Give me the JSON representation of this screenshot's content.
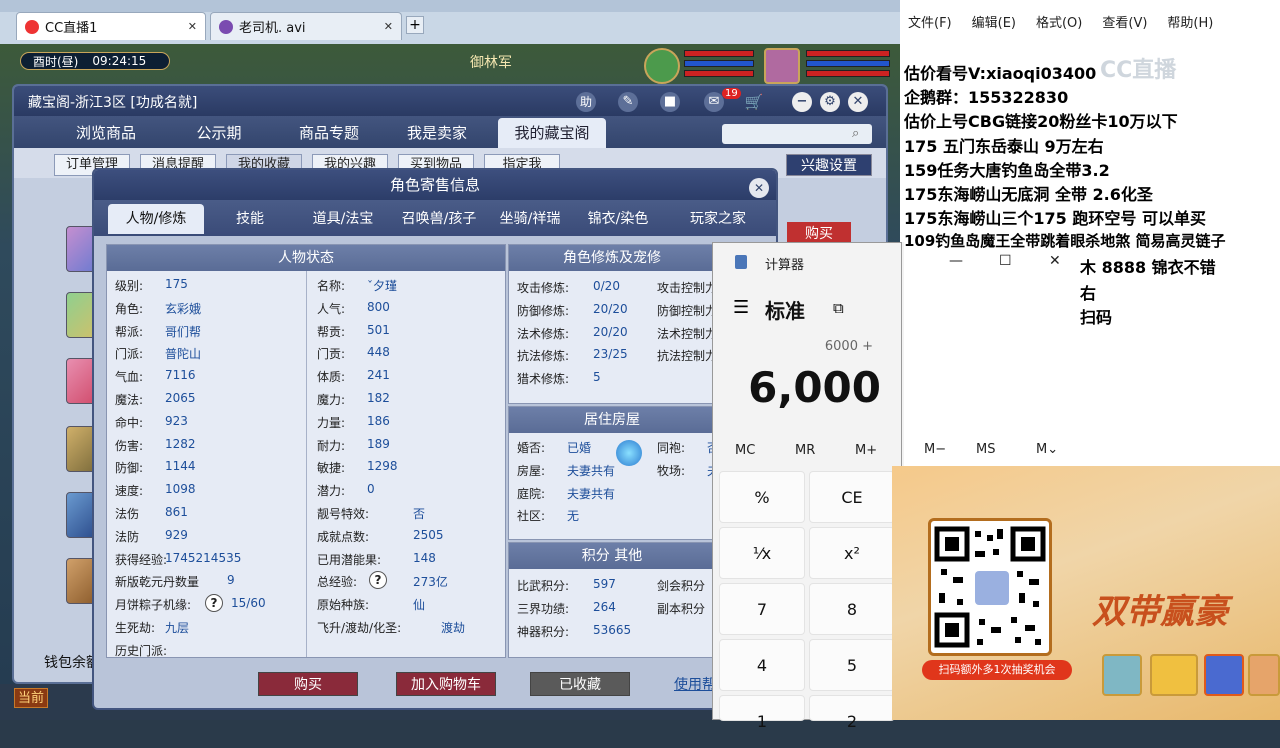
{
  "browser": {
    "tabs": [
      {
        "label": "CC直播1",
        "icon": "cc-logo-icon"
      },
      {
        "label": "老司机. avi",
        "icon": "avatar-icon"
      }
    ]
  },
  "game_hud": {
    "time_label": "酉时(昼)",
    "clock": "09:24:15",
    "banner": "御林军",
    "bottom_button": "当前"
  },
  "store": {
    "title": "藏宝阁-浙江3区 [功成名就]",
    "help_label": "助",
    "cart_badge": "19",
    "nav": [
      "浏览商品",
      "公示期",
      "商品专题",
      "我是卖家",
      "我的藏宝阁"
    ],
    "nav_active": 4,
    "subnav": [
      "订单管理",
      "消息提醒",
      "我的收藏",
      "我的兴趣",
      "买到物品",
      "指定我"
    ],
    "interest_button": "兴趣设置",
    "side_buy": "购买",
    "wallet_label": "钱包余额"
  },
  "dialog": {
    "title": "角色寄售信息",
    "close": "✕",
    "tabs": [
      "人物/修炼",
      "技能",
      "道具/法宝",
      "召唤兽/孩子",
      "坐骑/祥瑞",
      "锦衣/染色",
      "玩家之家"
    ],
    "status_title": "人物状态",
    "left_col": [
      {
        "k": "级别:",
        "v": "175"
      },
      {
        "k": "角色:",
        "v": "玄彩娥"
      },
      {
        "k": "帮派:",
        "v": "哥们帮"
      },
      {
        "k": "门派:",
        "v": "普陀山"
      },
      {
        "k": "气血:",
        "v": "7116"
      },
      {
        "k": "魔法:",
        "v": "2065"
      },
      {
        "k": "命中:",
        "v": "923"
      },
      {
        "k": "伤害:",
        "v": "1282"
      },
      {
        "k": "防御:",
        "v": "1144"
      },
      {
        "k": "速度:",
        "v": "1098"
      },
      {
        "k": "法伤",
        "v": "861"
      },
      {
        "k": "法防",
        "v": "929"
      },
      {
        "k": "获得经验:",
        "v": "1745214535"
      },
      {
        "k": "新版乾元丹数量",
        "v": "9"
      },
      {
        "k": "月饼粽子机缘:",
        "v": "15/60"
      },
      {
        "k": "生死劫:",
        "v": "九层"
      },
      {
        "k": "历史门派:",
        "v": ""
      }
    ],
    "mid_col": [
      {
        "k": "名称:",
        "v": "ˇ夕瑾"
      },
      {
        "k": "人气:",
        "v": "800"
      },
      {
        "k": "帮贡:",
        "v": "501"
      },
      {
        "k": "门贡:",
        "v": "448"
      },
      {
        "k": "体质:",
        "v": "241"
      },
      {
        "k": "魔力:",
        "v": "182"
      },
      {
        "k": "力量:",
        "v": "186"
      },
      {
        "k": "耐力:",
        "v": "189"
      },
      {
        "k": "敏捷:",
        "v": "1298"
      },
      {
        "k": "潜力:",
        "v": "0"
      },
      {
        "k": "靓号特效:",
        "v": "否"
      },
      {
        "k": "成就点数:",
        "v": "2505"
      },
      {
        "k": "已用潜能果:",
        "v": "148"
      },
      {
        "k": "总经验:",
        "v": "273亿"
      },
      {
        "k": "原始种族:",
        "v": "仙"
      },
      {
        "k": "飞升/渡劫/化圣:",
        "v": "渡劫"
      }
    ],
    "cultivation_title": "角色修炼及宠修",
    "cultivation": [
      {
        "k": "攻击修炼:",
        "v": "0/20",
        "k2": "攻击控制力"
      },
      {
        "k": "防御修炼:",
        "v": "20/20",
        "k2": "防御控制力"
      },
      {
        "k": "法术修炼:",
        "v": "20/20",
        "k2": "法术控制力"
      },
      {
        "k": "抗法修炼:",
        "v": "23/25",
        "k2": "抗法控制力"
      },
      {
        "k": "猎术修炼:",
        "v": "5",
        "k2": ""
      }
    ],
    "house_title": "居住房屋",
    "house": [
      {
        "k": "婚否:",
        "v": "已婚",
        "k2": "同袍:",
        "v2": "否"
      },
      {
        "k": "房屋:",
        "v": "夫妻共有",
        "k2": "牧场:",
        "v2": "夫"
      },
      {
        "k": "庭院:",
        "v": "夫妻共有",
        "k2": "",
        "v2": ""
      },
      {
        "k": "社区:",
        "v": "无",
        "k2": "",
        "v2": ""
      }
    ],
    "score_title": "积分 其他",
    "scores": [
      {
        "k": "比武积分:",
        "v": "597",
        "k2": "剑会积分"
      },
      {
        "k": "三界功绩:",
        "v": "264",
        "k2": "副本积分"
      },
      {
        "k": "神器积分:",
        "v": "53665",
        "k2": ""
      }
    ],
    "buttons": {
      "buy": "购买",
      "cart": "加入购物车",
      "fav": "已收藏",
      "help": "使用帮助"
    }
  },
  "notepad": {
    "menu": [
      "文件(F)",
      "编辑(E)",
      "格式(O)",
      "查看(V)",
      "帮助(H)"
    ],
    "lines": [
      "估价看号V:xiaoqi03400",
      "企鹅群：155322830",
      "估价上号CBG链接20粉丝卡10万以下",
      "175 五门东岳泰山  9万左右",
      "159任务大唐钓鱼岛全带3.2",
      "175东海崂山无底洞  全带   2.6化圣",
      "175东海崂山三个175 跑环空号 可以单买",
      "109钓鱼岛魔王全带跳着眼杀地煞 简易高灵链子",
      "木 8888 锦衣不错",
      "右",
      "扫码"
    ],
    "watermark": "CC直播"
  },
  "calculator": {
    "title": "计算器",
    "mode": "标准",
    "expression": "6000 +",
    "display": "6,000",
    "memory": [
      "MC",
      "MR",
      "M+",
      "M−",
      "MS",
      "M⌄"
    ],
    "keys": [
      "%",
      "CE",
      "¹⁄x",
      "x²",
      "7",
      "8",
      "4",
      "5",
      "1",
      "2"
    ]
  },
  "ad": {
    "slogan": "双带赢豪",
    "qr_banner": "扫码额外多1次抽奖机会"
  }
}
